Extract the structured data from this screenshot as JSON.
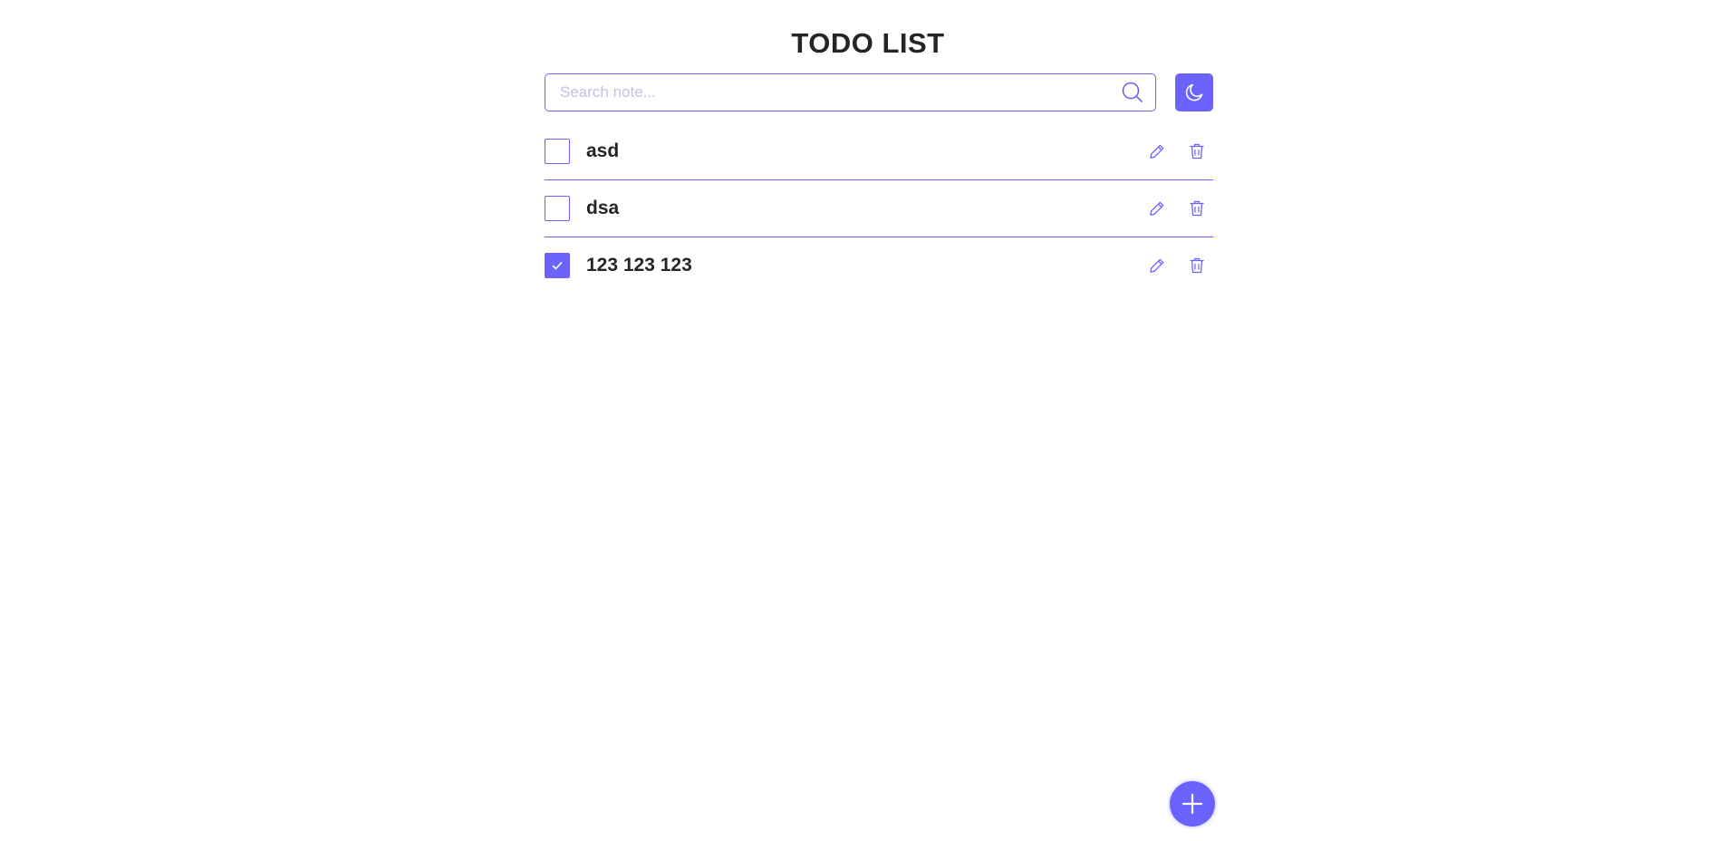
{
  "header": {
    "title": "TODO LIST"
  },
  "search": {
    "placeholder": "Search note...",
    "value": "",
    "icon": "search-icon"
  },
  "theme_toggle": {
    "icon": "moon-icon"
  },
  "todos": [
    {
      "text": "asd",
      "checked": false
    },
    {
      "text": "dsa",
      "checked": false
    },
    {
      "text": "123 123 123",
      "checked": true
    }
  ],
  "item_actions": {
    "edit_icon": "pencil-icon",
    "delete_icon": "trash-icon"
  },
  "add_button": {
    "icon": "plus-icon"
  },
  "colors": {
    "accent": "#6c63ff",
    "text": "#252525",
    "placeholder": "#c3c1e5",
    "background": "#ffffff"
  }
}
